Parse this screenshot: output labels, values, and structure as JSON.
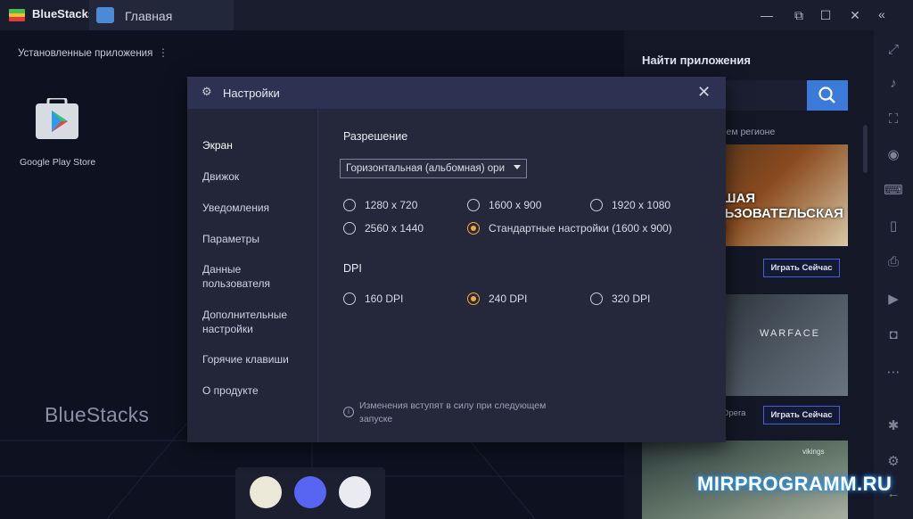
{
  "titlebar": {
    "brand": "BlueStacks",
    "tab_label": "Главная",
    "buttons": [
      "minimize",
      "maximize",
      "close"
    ]
  },
  "home": {
    "installed_title": "Установленные приложения",
    "installed_more": "⋮",
    "apps": [
      {
        "label": "Google Play Store",
        "icon": "google-play-icon"
      }
    ],
    "watermark": "BlueStacks",
    "dock_icons": [
      "app-center-icon",
      "discord-icon",
      "game-icon"
    ]
  },
  "right_panel": {
    "title": "Найти приложения",
    "region_label": "...вашем регионе",
    "cards": [
      {
        "button": "Играть Сейчас",
        "banner_text": "ЛУЧШАЯ ПОЛЬЗОВАТЕЛЬСКАЯ РПГ!"
      },
      {
        "button": "Играть Сейчас",
        "banner_text": "WARFACE",
        "caption": "Opera"
      },
      {
        "banner_text": "vikings"
      }
    ]
  },
  "settings": {
    "title": "Настройки",
    "nav": [
      "Экран",
      "Движок",
      "Уведомления",
      "Параметры",
      "Данные пользователя",
      "Дополнительные настройки",
      "Горячие клавиши",
      "О продукте"
    ],
    "nav_active": 0,
    "resolution": {
      "title": "Разрешение",
      "orientation_value": "Горизонтальная (альбомная) ори",
      "options": [
        "1280 x 720",
        "1600 x 900",
        "1920 x 1080",
        "2560 x 1440",
        "Стандартные настройки (1600 x 900)"
      ],
      "selected": "Стандартные настройки (1600 x 900)"
    },
    "dpi": {
      "title": "DPI",
      "options": [
        "160 DPI",
        "240 DPI",
        "320 DPI"
      ],
      "selected": "240 DPI"
    },
    "note": "Изменения вступят в силу при следующем запуске"
  },
  "site_watermark": "MIRPROGRAMM.RU",
  "colors": {
    "accent": "#f2a93b",
    "search": "#3c7ad9",
    "header": "#2e3252"
  }
}
